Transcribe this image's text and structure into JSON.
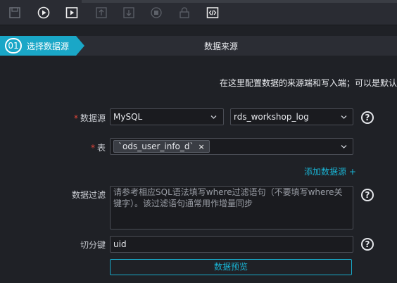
{
  "toolbar": {
    "buttons": [
      {
        "icon": "save-icon",
        "enabled": false
      },
      {
        "icon": "run-icon",
        "enabled": true
      },
      {
        "icon": "run-config-icon",
        "enabled": true
      },
      {
        "icon": "submit-icon",
        "enabled": false
      },
      {
        "icon": "download-icon",
        "enabled": false
      },
      {
        "icon": "stop-icon",
        "enabled": false
      },
      {
        "icon": "lock-icon",
        "enabled": false
      },
      {
        "icon": "code-mode-icon",
        "enabled": true
      }
    ]
  },
  "steps": {
    "active_number": "01",
    "active_label": "选择数据源",
    "next_label": "数据来源"
  },
  "info_text": "在这里配置数据的来源端和写入端；可以是默认",
  "form": {
    "datasource": {
      "label": "数据源",
      "type_value": "MySQL",
      "name_value": "rds_workshop_log"
    },
    "table": {
      "label": "表",
      "tag": "`ods_user_info_d`",
      "tag_close": "×"
    },
    "add_source_link": "添加数据源 +",
    "filter": {
      "label": "数据过滤",
      "placeholder": "请参考相应SQL语法填写where过滤语句（不要填写where关键字）。该过滤语句通常用作增量同步"
    },
    "split_key": {
      "label": "切分键",
      "value": "uid"
    },
    "preview_button": "数据预览",
    "help_glyph": "?"
  },
  "colors": {
    "accent": "#1ab2d2",
    "required": "#e0453a",
    "background": "#1f2126"
  }
}
